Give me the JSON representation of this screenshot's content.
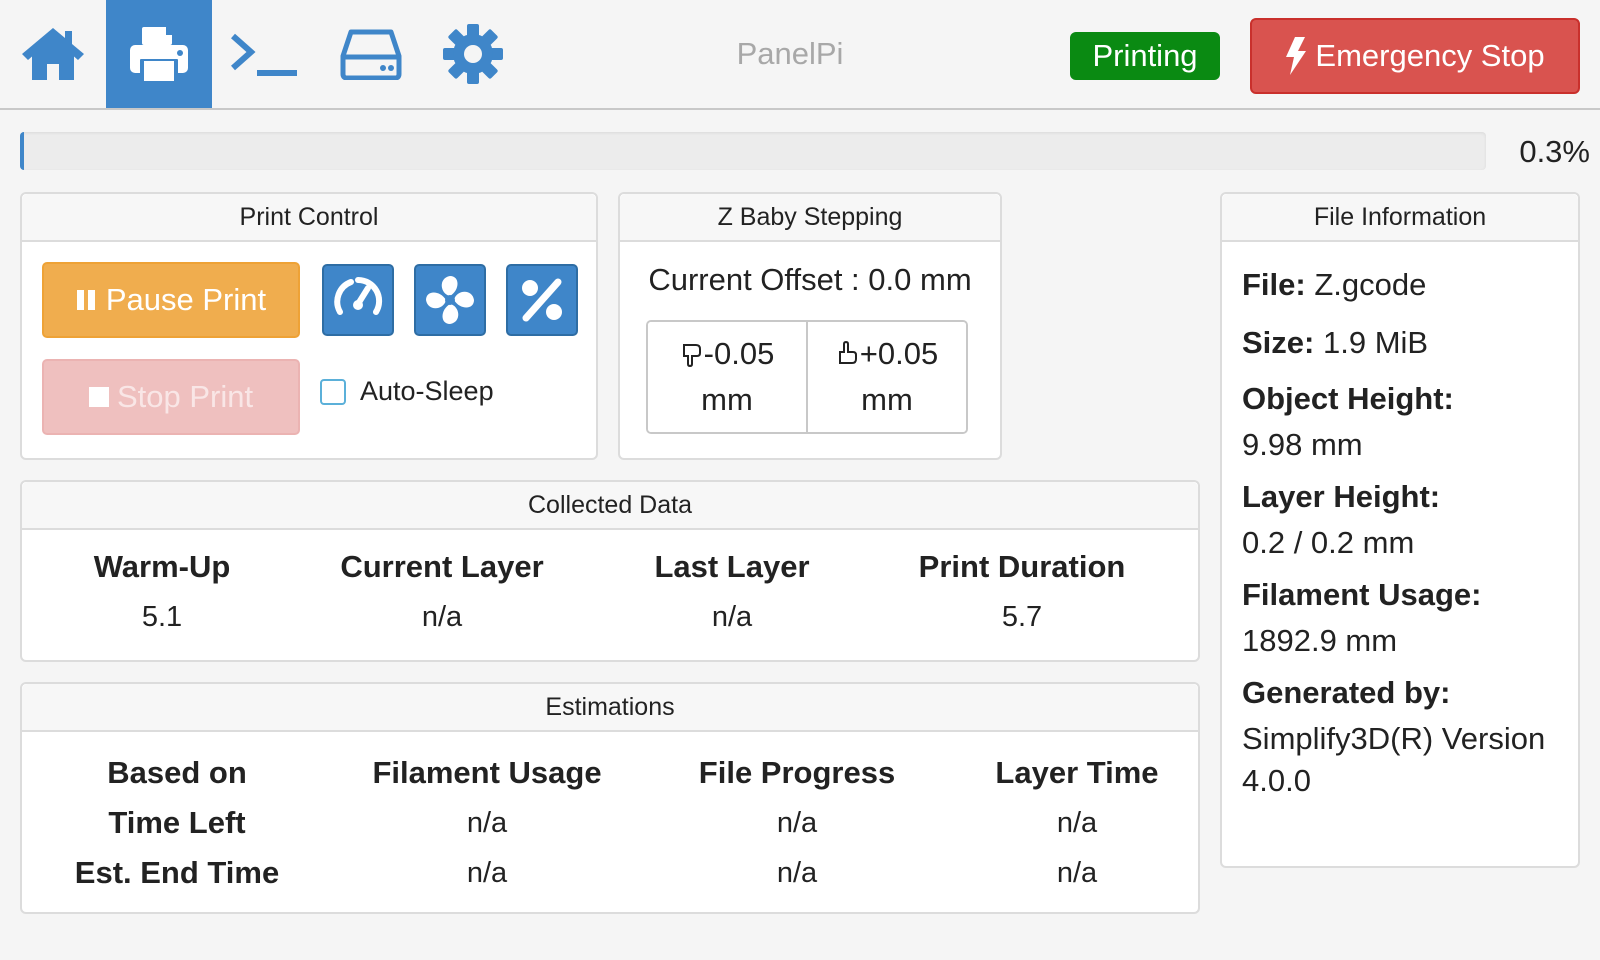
{
  "nav": {
    "items": [
      {
        "name": "home",
        "icon": "home-icon"
      },
      {
        "name": "print",
        "icon": "printer-icon",
        "active": true
      },
      {
        "name": "terminal",
        "icon": "terminal-icon"
      },
      {
        "name": "storage",
        "icon": "drive-icon"
      },
      {
        "name": "settings",
        "icon": "gear-icon"
      }
    ],
    "title": "PanelPi",
    "status": "Printing",
    "emergency_stop_label": "Emergency Stop"
  },
  "progress": {
    "value": 0.003,
    "text": "0.3%"
  },
  "print_control": {
    "title": "Print Control",
    "pause_label": "Pause Print",
    "stop_label": "Stop Print",
    "auto_sleep_label": "Auto-Sleep",
    "auto_sleep_checked": false
  },
  "z_baby_stepping": {
    "title": "Z Baby Stepping",
    "offset_label": "Current Offset :",
    "offset_value": "0.0",
    "offset_unit": "mm",
    "down_value": "-0.05",
    "up_value": "+0.05",
    "unit": "mm"
  },
  "collected_data": {
    "title": "Collected Data",
    "columns": [
      {
        "header": "Warm-Up",
        "value": "5.1"
      },
      {
        "header": "Current Layer",
        "value": "n/a"
      },
      {
        "header": "Last Layer",
        "value": "n/a"
      },
      {
        "header": "Print Duration",
        "value": "5.7"
      }
    ]
  },
  "estimations": {
    "title": "Estimations",
    "headers": [
      "Based on",
      "Filament Usage",
      "File Progress",
      "Layer Time"
    ],
    "rows": [
      {
        "label": "Time Left",
        "values": [
          "n/a",
          "n/a",
          "n/a"
        ]
      },
      {
        "label": "Est. End Time",
        "values": [
          "n/a",
          "n/a",
          "n/a"
        ]
      }
    ]
  },
  "file_info": {
    "title": "File Information",
    "file_label": "File:",
    "file_value": "Z.gcode",
    "size_label": "Size:",
    "size_value": "1.9 MiB",
    "object_height_label": "Object Height:",
    "object_height_value": "9.98 mm",
    "layer_height_label": "Layer Height:",
    "layer_height_value": "0.2 / 0.2 mm",
    "filament_usage_label": "Filament Usage:",
    "filament_usage_value": "1892.9 mm",
    "generated_by_label": "Generated by:",
    "generated_by_value": "Simplify3D(R) Version 4.0.0"
  },
  "colors": {
    "accent": "#3f86c9",
    "status_green": "#0a8a12",
    "danger": "#d9534f",
    "warning": "#f0ad4e"
  }
}
